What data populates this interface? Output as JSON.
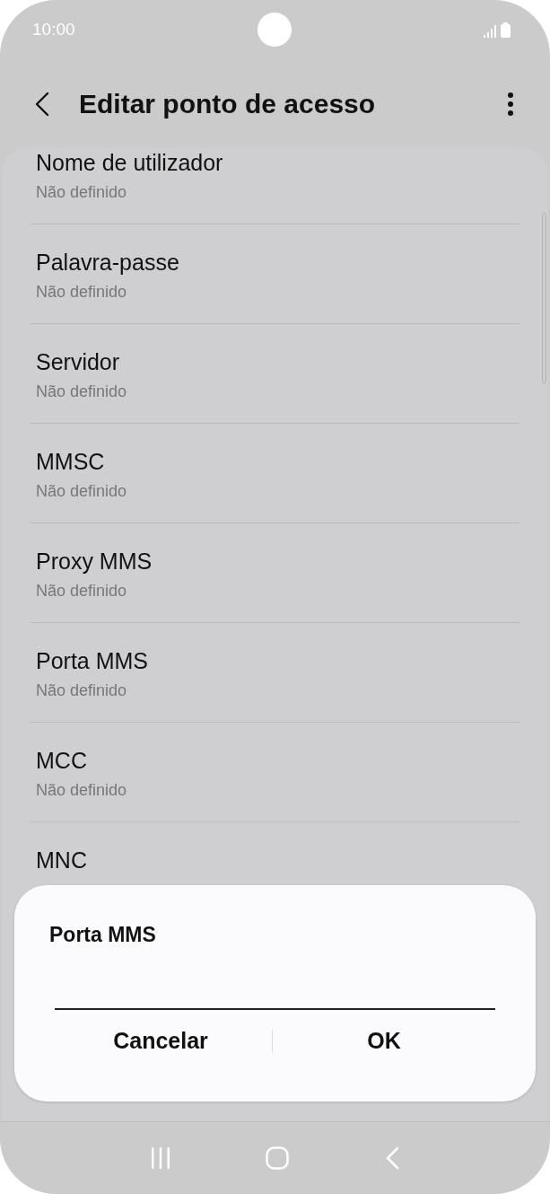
{
  "status_bar": {
    "time": "10:00"
  },
  "header": {
    "title": "Editar ponto de acesso"
  },
  "settings": [
    {
      "title": "Nome de utilizador",
      "value": "Não definido"
    },
    {
      "title": "Palavra-passe",
      "value": "Não definido"
    },
    {
      "title": "Servidor",
      "value": "Não definido"
    },
    {
      "title": "MMSC",
      "value": "Não definido"
    },
    {
      "title": "Proxy MMS",
      "value": "Não definido"
    },
    {
      "title": "Porta MMS",
      "value": "Não definido"
    },
    {
      "title": "MCC",
      "value": "Não definido"
    },
    {
      "title": "MNC"
    }
  ],
  "dialog": {
    "title": "Porta MMS",
    "buttons": [
      "Cancelar",
      "OK"
    ]
  }
}
